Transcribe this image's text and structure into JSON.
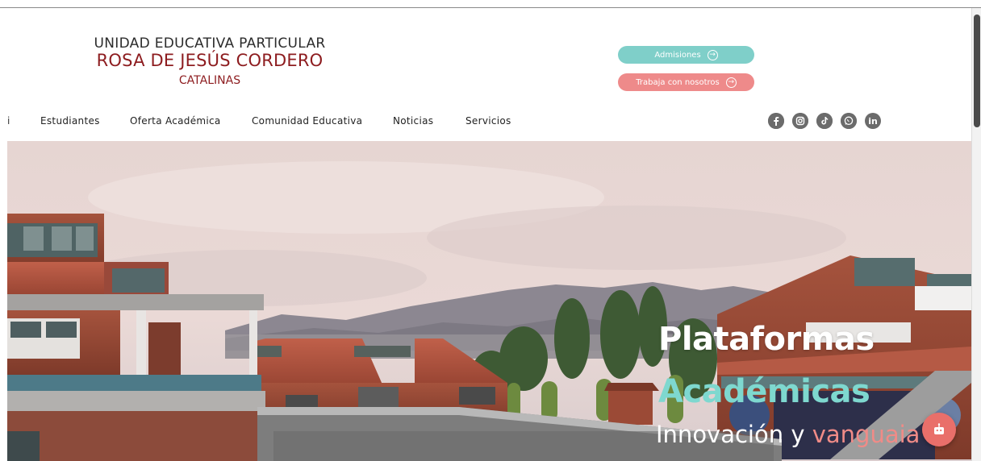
{
  "logo": {
    "line1": "UNIDAD EDUCATIVA PARTICULAR",
    "line2": "ROSA DE JESÚS CORDERO",
    "line3": "CATALINAS"
  },
  "cta": {
    "admisiones": "Admisiones",
    "trabaja": "Trabaja con nosotros"
  },
  "nav": {
    "bullet": "i",
    "items": [
      "Estudiantes",
      "Oferta Académica",
      "Comunidad Educativa",
      "Noticias",
      "Servicios"
    ]
  },
  "social": {
    "icons": [
      "facebook-icon",
      "instagram-icon",
      "tiktok-icon",
      "whatsapp-icon",
      "linkedin-icon"
    ],
    "linkedin_text": "in"
  },
  "hero": {
    "title1": "Plataformas",
    "title2": "Académicas",
    "sub_a": "Innovación y ",
    "sub_b": "vangua",
    "sub_c": "ia"
  },
  "colors": {
    "brand_red": "#8d1c1f",
    "teal": "#7fcfc9",
    "coral": "#ee8a8a",
    "accent_teal": "#7ed8cf"
  }
}
